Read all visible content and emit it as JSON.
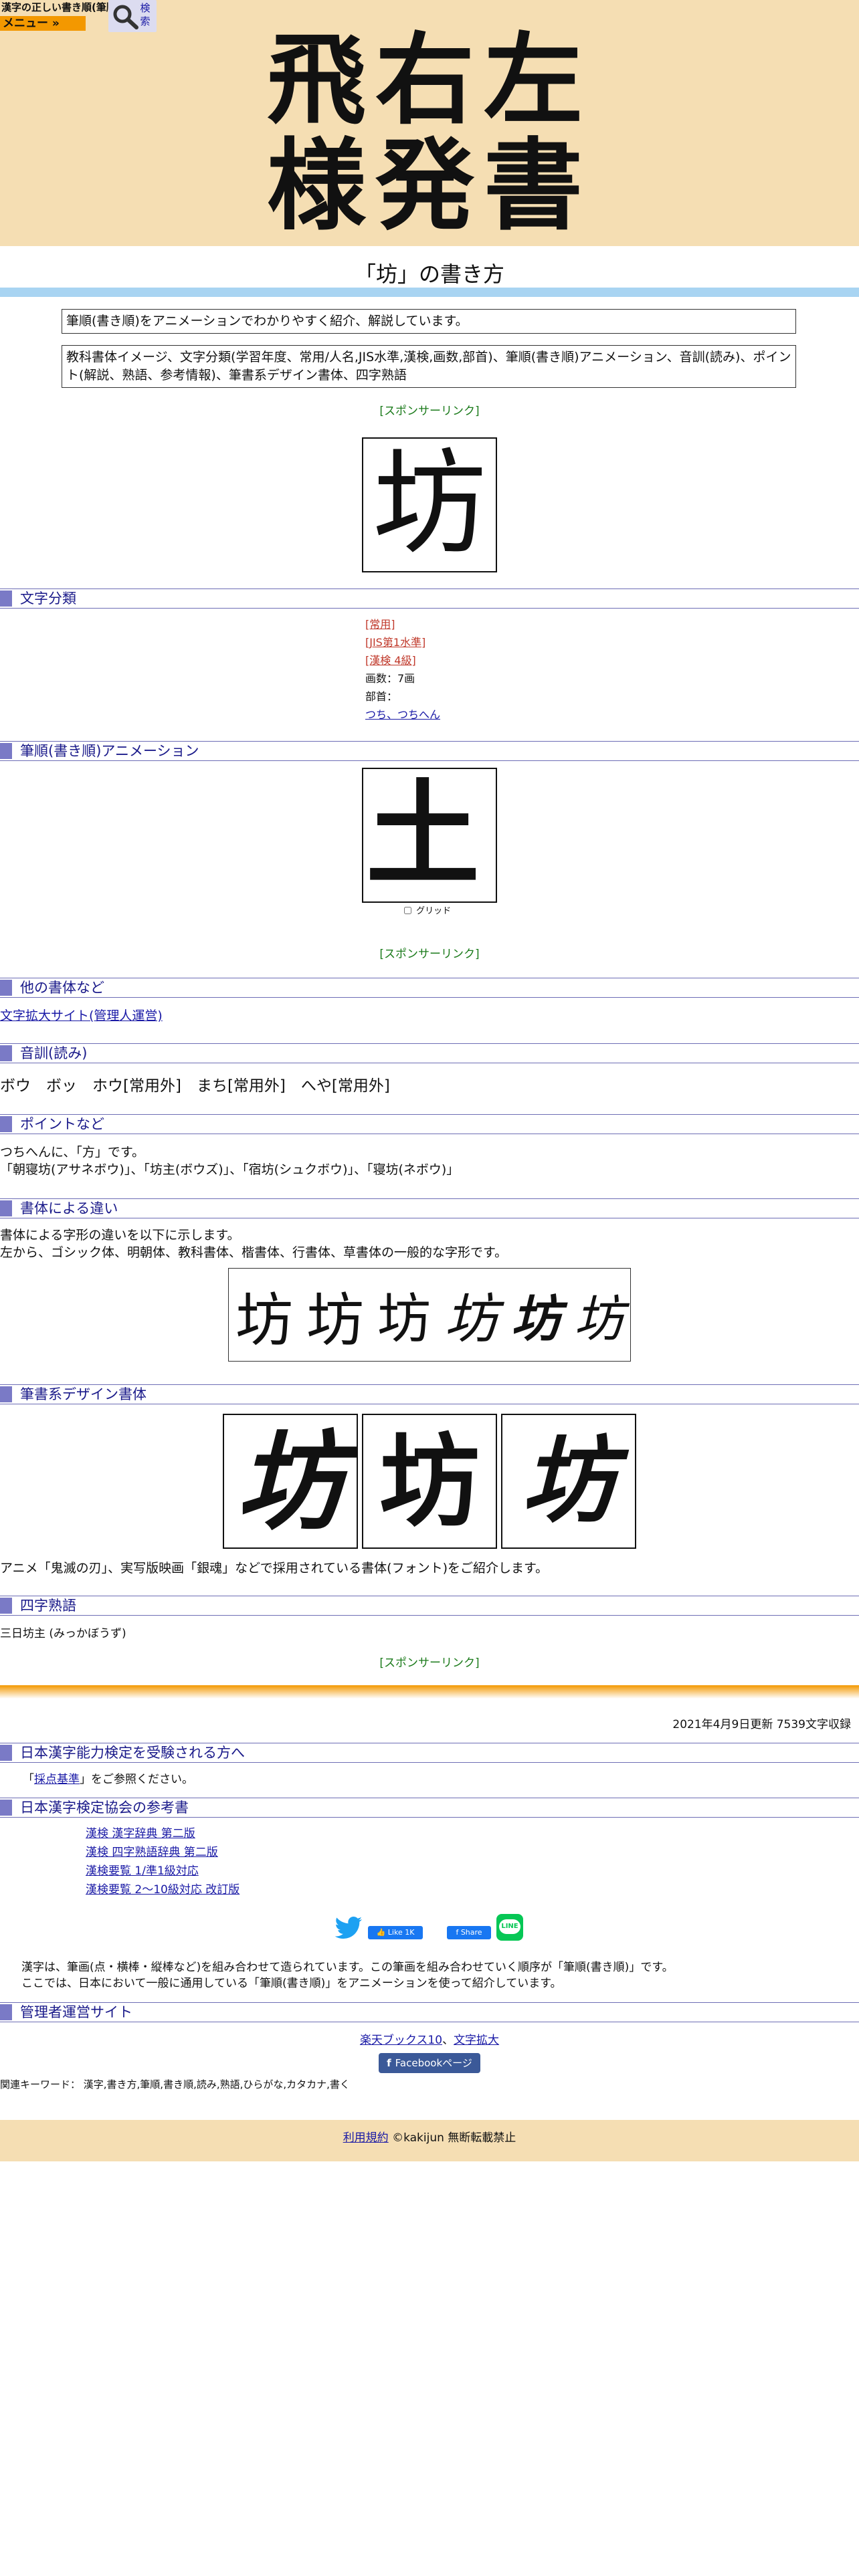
{
  "header": {
    "logo_text": "漢字の正しい書き順(筆順)",
    "menu_label": "メニュー »",
    "search_label": "検索"
  },
  "banner": {
    "title_line1": "飛右左",
    "title_line2": "様発書"
  },
  "page": {
    "title": "「坊」の書き方",
    "intro": "筆順(書き順)をアニメーションでわかりやすく紹介、解説しています。",
    "summary": "教科書体イメージ、文字分類(学習年度、常用/人名,JIS水準,漢検,画数,部首)、筆順(書き順)アニメーション、音訓(読み)、ポイント(解説、熟語、参考情報)、筆書系デザイン書体、四字熟語",
    "kanji": "坊",
    "sponsor": "[スポンサーリンク]"
  },
  "sections": {
    "classification": "文字分類",
    "animation": "筆順(書き順)アニメーション",
    "other_fonts": "他の書体など",
    "readings": "音訓(読み)",
    "points": "ポイントなど",
    "font_diff": "書体による違い",
    "design_fonts": "筆書系デザイン書体",
    "yoji": "四字熟語",
    "kentei_takers": "日本漢字能力検定を受験される方へ",
    "kentei_refs": "日本漢字検定協会の参考書",
    "admin": "管理者運営サイト"
  },
  "classification": {
    "jouyou": "[常用]",
    "jis": "[JIS第1水準]",
    "kanken": "[漢検 4級]",
    "strokes": "画数：7画",
    "radical_label": "部首：",
    "radical_link": "つち、つちへん"
  },
  "animation": {
    "grid_label": "グリッド",
    "kanji_partial": "土"
  },
  "other_fonts": {
    "link": "文字拡大サイト(管理人運営)"
  },
  "readings": {
    "text": "ボウ　ボッ　ホウ[常用外]　まち[常用外]　へや[常用外]"
  },
  "points": {
    "line1": "つちへんに、「方」です。",
    "line2": "「朝寝坊(アサネボウ)」、「坊主(ボウズ)」、「宿坊(シュクボウ)」、「寝坊(ネボウ)」"
  },
  "font_diff": {
    "line1": "書体による字形の違いを以下に示します。",
    "line2": "左から、ゴシック体、明朝体、教科書体、楷書体、行書体、草書体の一般的な字形です。"
  },
  "design_fonts": {
    "caption": "アニメ「鬼滅の刃」、実写版映画「銀魂」などで採用されている書体(フォント)をご紹介します。"
  },
  "yoji": {
    "text": "三日坊主 (みっかぼうず)"
  },
  "footer": {
    "updated": "2021年4月9日更新 7539文字収録",
    "kentei_prefix": "「",
    "kentei_link": "採点基準",
    "kentei_suffix": "」をご参照ください。",
    "refs": [
      "漢検 漢字辞典 第二版",
      "漢検 四字熟語辞典 第二版",
      "漢検要覧 1/準1級対応",
      "漢検要覧 2～10級対応 改訂版"
    ],
    "like_label": "Like 1K",
    "share_label": "Share",
    "line_label": "LINE",
    "explain1": "漢字は、筆画(点・横棒・縦棒など)を組み合わせて造られています。この筆画を組み合わせていく順序が「筆順(書き順)」です。",
    "explain2": "ここでは、日本において一般に通用している「筆順(書き順)」をアニメーションを使って紹介しています。",
    "admin_link1": "楽天ブックス10",
    "admin_sep": "、",
    "admin_link2": "文字拡大",
    "facebook_page": "Facebookページ",
    "keywords": "関連キーワード： 漢字,書き方,筆順,書き順,読み,熟語,ひらがな,カタカナ,書く",
    "terms": "利用規約",
    "copyright": "©kakijun 無断転載禁止"
  },
  "colors": {
    "banner": "#f5deb3",
    "menu": "#f39800",
    "accent": "#7a7ac6",
    "title_bar": "#a8d4f2"
  }
}
